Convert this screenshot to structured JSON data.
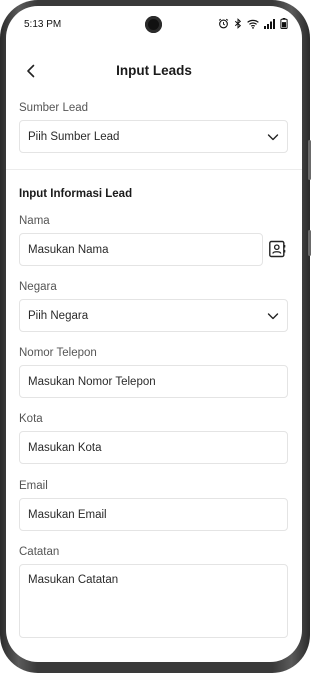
{
  "status_bar": {
    "time": "5:13 PM"
  },
  "header": {
    "title": "Input Leads"
  },
  "source": {
    "label": "Sumber Lead",
    "select_value": "Piih Sumber Lead"
  },
  "section": {
    "title": "Input Informasi Lead"
  },
  "form": {
    "name": {
      "label": "Nama",
      "placeholder": "Masukan Nama"
    },
    "country": {
      "label": "Negara",
      "select_value": "Piih Negara"
    },
    "phone": {
      "label": "Nomor Telepon",
      "placeholder": "Masukan Nomor Telepon"
    },
    "city": {
      "label": "Kota",
      "placeholder": "Masukan Kota"
    },
    "email": {
      "label": "Email",
      "placeholder": "Masukan Email"
    },
    "notes": {
      "label": "Catatan",
      "placeholder": "Masukan Catatan"
    }
  },
  "icons": {
    "back": "chevron-left-icon",
    "dropdown": "chevron-down-icon",
    "contact": "contact-book-icon"
  }
}
